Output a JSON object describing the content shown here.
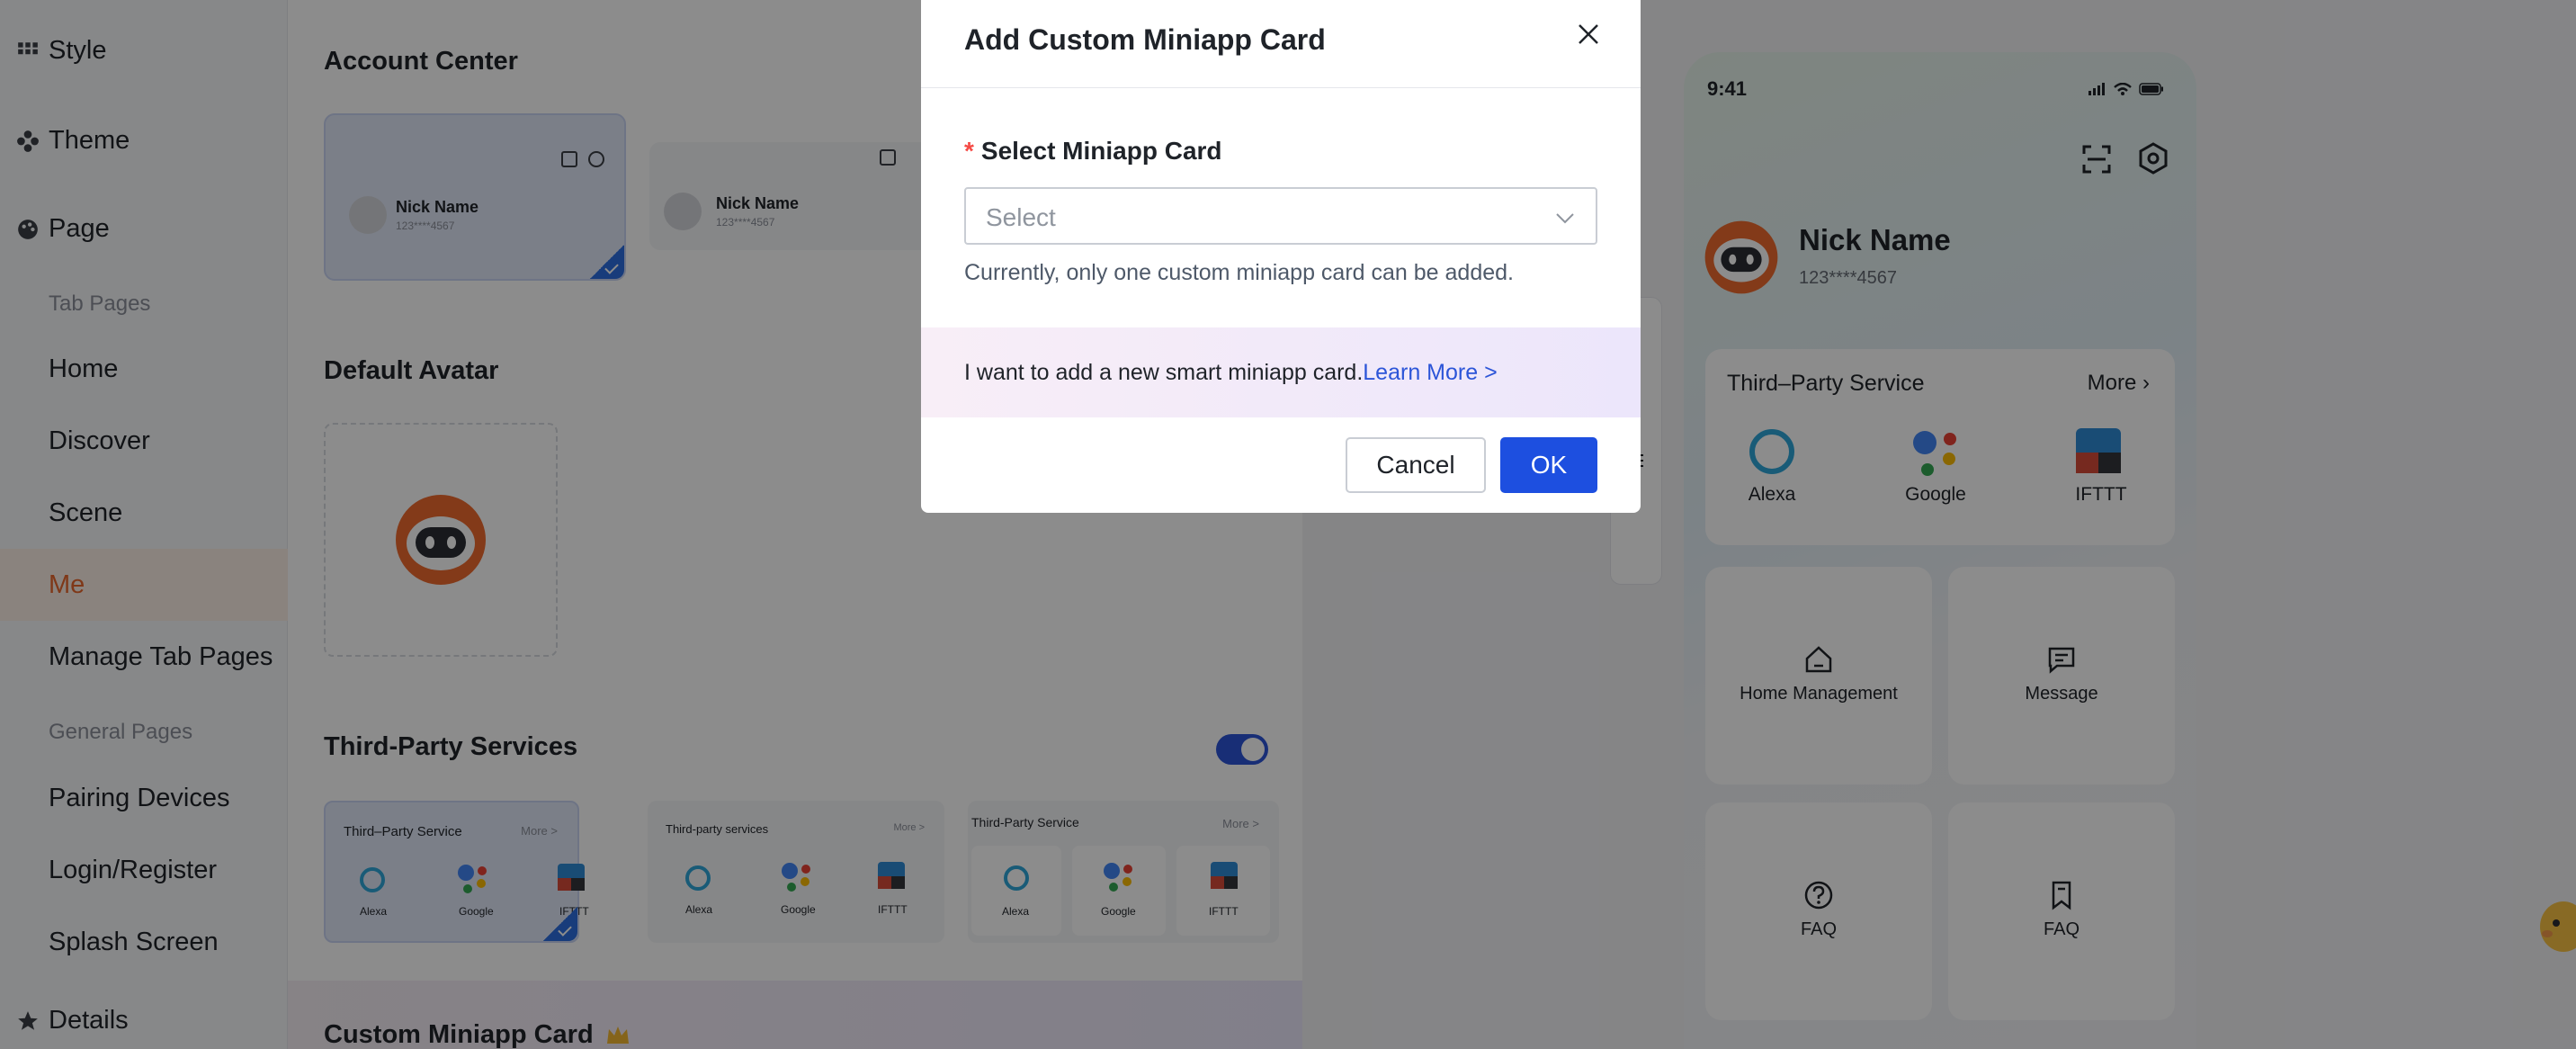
{
  "sidebar": {
    "sections": {
      "style": "Style",
      "theme": "Theme",
      "page": "Page",
      "details": "Details"
    },
    "tab_pages_label": "Tab Pages",
    "tab_pages": [
      "Home",
      "Discover",
      "Scene",
      "Me",
      "Manage Tab Pages"
    ],
    "active_item": "Me",
    "general_pages_label": "General Pages",
    "general_pages": [
      "Pairing Devices",
      "Login/Register",
      "Splash Screen"
    ]
  },
  "config": {
    "account_center_title": "Account Center",
    "account_cards": [
      {
        "name": "Nick Name",
        "phone": "123****4567",
        "selected": true
      },
      {
        "name": "Nick Name",
        "phone": "123****4567",
        "selected": false
      }
    ],
    "default_avatar_title": "Default Avatar",
    "third_party_title": "Third-Party Services",
    "third_party_enabled": true,
    "third_party_cards": [
      {
        "title": "Third–Party Service",
        "more": "More >",
        "items": [
          "Alexa",
          "Google",
          "IFTTT"
        ],
        "selected": true
      },
      {
        "title": "Third-party services",
        "more": "More >",
        "items": [
          "Alexa",
          "Google",
          "IFTTT"
        ],
        "selected": false
      },
      {
        "title": "Third-Party Service",
        "more": "More >",
        "items": [
          "Alexa",
          "Google",
          "IFTTT"
        ],
        "selected": false
      }
    ],
    "custom_miniapp_title": "Custom Miniapp Card"
  },
  "preview": {
    "time": "9:41",
    "user_name": "Nick Name",
    "user_phone": "123****4567",
    "service_card": {
      "title": "Third–Party Service",
      "more": "More",
      "items": [
        "Alexa",
        "Google",
        "IFTTT"
      ]
    },
    "tiles": [
      "Home Management",
      "Message",
      "FAQ",
      "FAQ"
    ]
  },
  "modal": {
    "title": "Add Custom Miniapp Card",
    "required_mark": "*",
    "field_label": "Select Miniapp Card",
    "select_placeholder": "Select",
    "hint": "Currently, only one custom miniapp card can be added.",
    "banner_text": "I want to add a new smart miniapp card.",
    "banner_link": "Learn More >",
    "cancel_label": "Cancel",
    "ok_label": "OK"
  },
  "colors": {
    "accent": "#1d4fe0",
    "active_nav": "#e8672c",
    "required": "#f54a45",
    "link": "#2c55d8"
  },
  "icons": [
    "grid-icon",
    "theme-icon",
    "page-icon",
    "star-icon",
    "close-icon",
    "chevron-down-icon",
    "scan-icon",
    "settings-icon",
    "alexa-icon",
    "google-icon",
    "ifttt-icon",
    "home-icon",
    "message-icon",
    "help-icon",
    "bookmark-icon"
  ]
}
